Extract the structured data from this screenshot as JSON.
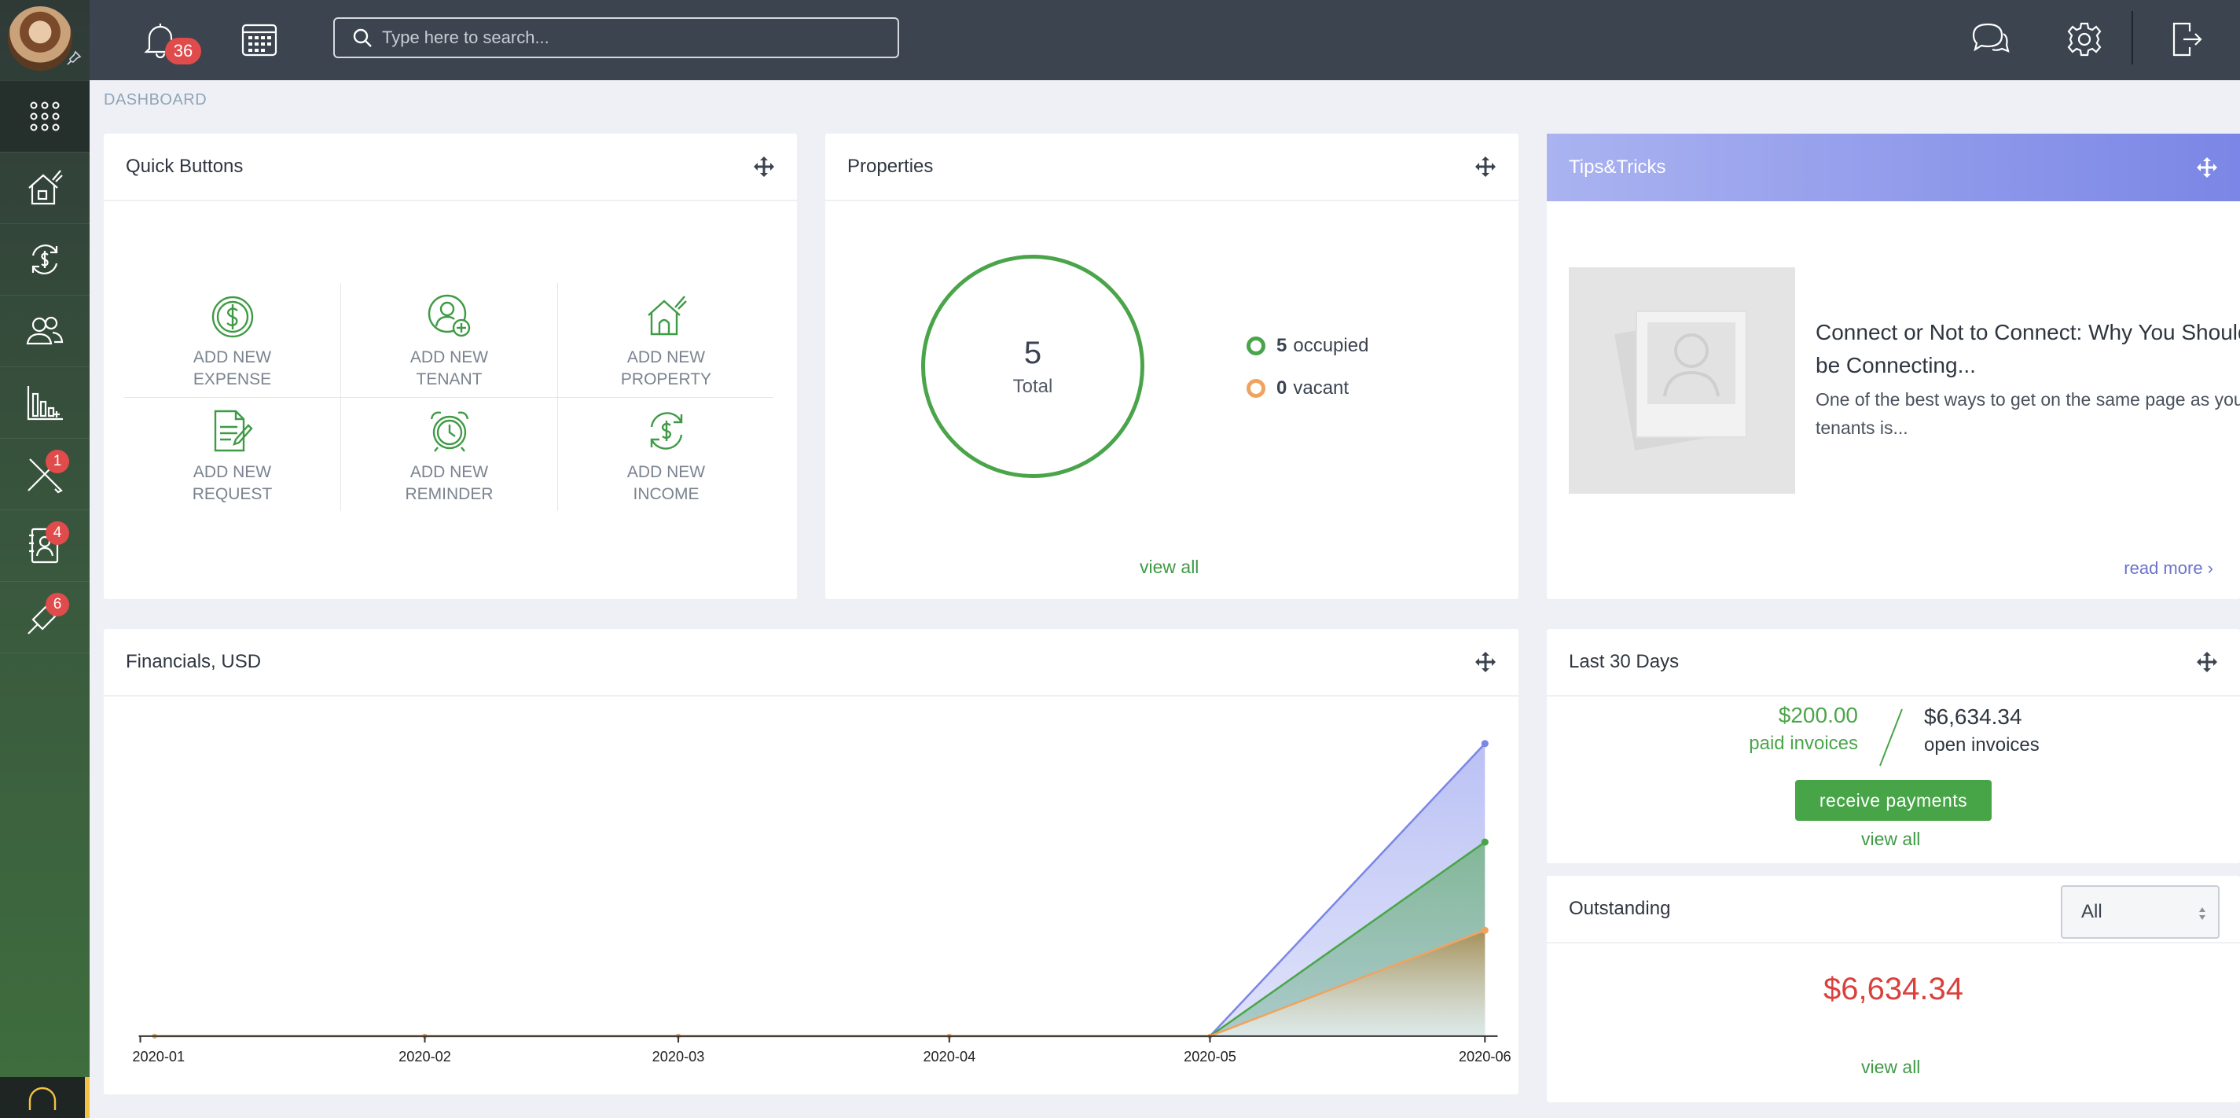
{
  "topbar": {
    "notification_count": "36",
    "search_placeholder": "Type here to search..."
  },
  "sidebar": {
    "items": [
      {
        "name": "apps",
        "icon": "grid-icon",
        "badge": ""
      },
      {
        "name": "properties",
        "icon": "house-icon",
        "badge": ""
      },
      {
        "name": "financials",
        "icon": "money-cycle-icon",
        "badge": ""
      },
      {
        "name": "tenants",
        "icon": "people-icon",
        "badge": ""
      },
      {
        "name": "reports",
        "icon": "bar-chart-icon",
        "badge": ""
      },
      {
        "name": "maintenance",
        "icon": "tools-icon",
        "badge": "1"
      },
      {
        "name": "leases",
        "icon": "contact-book-icon",
        "badge": "4"
      },
      {
        "name": "integrations",
        "icon": "plug-icon",
        "badge": "6"
      }
    ]
  },
  "breadcrumb": "DASHBOARD",
  "quick_buttons": {
    "title": "Quick Buttons",
    "items": [
      {
        "line1": "ADD NEW",
        "line2": "EXPENSE",
        "icon": "dollar-circle-icon"
      },
      {
        "line1": "ADD NEW",
        "line2": "TENANT",
        "icon": "add-user-icon"
      },
      {
        "line1": "ADD NEW",
        "line2": "PROPERTY",
        "icon": "house-icon"
      },
      {
        "line1": "ADD NEW",
        "line2": "REQUEST",
        "icon": "document-edit-icon"
      },
      {
        "line1": "ADD NEW",
        "line2": "REMINDER",
        "icon": "alarm-clock-icon"
      },
      {
        "line1": "ADD NEW",
        "line2": "INCOME",
        "icon": "money-cycle-icon"
      }
    ]
  },
  "properties": {
    "title": "Properties",
    "total_value": "5",
    "total_label": "Total",
    "occupied_count": "5",
    "occupied_label": "occupied",
    "vacant_count": "0",
    "vacant_label": "vacant",
    "view_all": "view all",
    "colors": {
      "occupied": "#4aa54a",
      "vacant": "#f0a35e"
    }
  },
  "tips": {
    "title": "Tips&Tricks",
    "article_title": "Connect or Not to Connect: Why You Should be Connecting...",
    "article_body": "One of the best ways to get on the same page as your tenants is...",
    "read_more": "read more ›"
  },
  "financials": {
    "title": "Financials, USD"
  },
  "chart_data": {
    "type": "area",
    "categories": [
      "2020-01",
      "2020-02",
      "2020-03",
      "2020-04",
      "2020-05",
      "2020-06"
    ],
    "series": [
      {
        "values": [
          0,
          0,
          0,
          0,
          0,
          6634.34
        ],
        "color": "#7b86e6"
      },
      {
        "values": [
          0,
          0,
          0,
          0,
          0,
          4400
        ],
        "color": "#4aa54a"
      },
      {
        "values": [
          0,
          0,
          0,
          0,
          0,
          2400
        ],
        "color": "#f0a35e"
      }
    ],
    "ylim": [
      0,
      6634.34
    ],
    "grid": false,
    "legend": "none"
  },
  "last30": {
    "title": "Last 30 Days",
    "paid_amount": "$200.00",
    "paid_label": "paid invoices",
    "open_amount": "$6,634.34",
    "open_label": "open invoices",
    "button": "receive payments",
    "view_all": "view all"
  },
  "outstanding": {
    "title": "Outstanding",
    "filter_value": "All",
    "amount": "$6,634.34",
    "view_all": "view all"
  }
}
